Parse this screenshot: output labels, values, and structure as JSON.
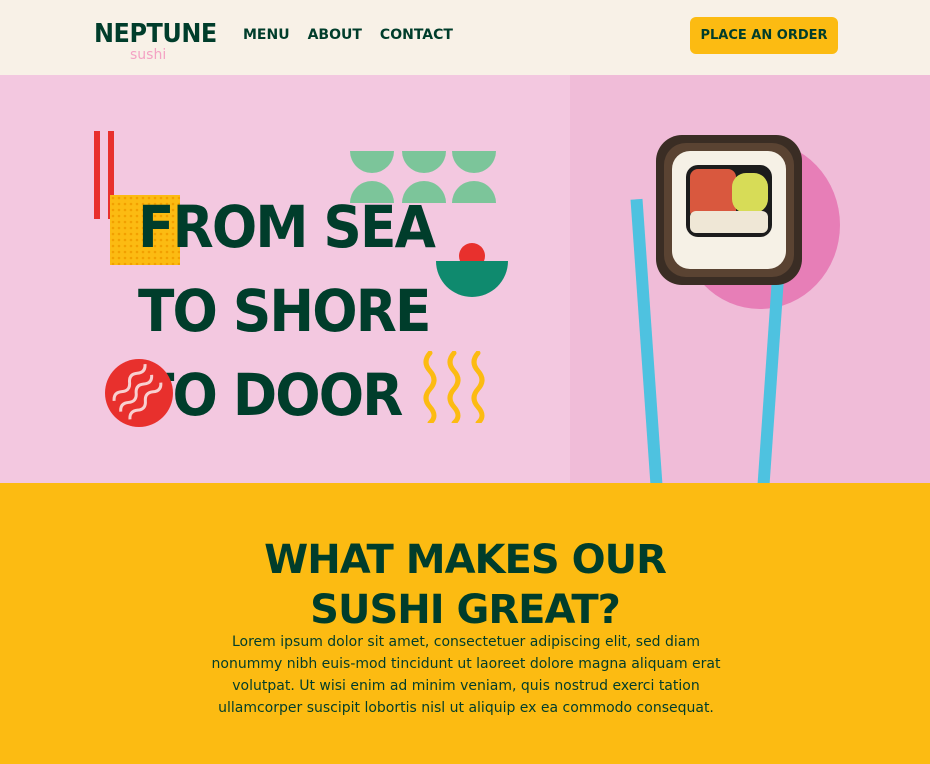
{
  "brand": {
    "name": "NEPTUNE",
    "sub": "sushi"
  },
  "nav": {
    "items": [
      "MENU",
      "ABOUT",
      "CONTACT"
    ]
  },
  "header": {
    "cta": "PLACE AN ORDER"
  },
  "hero": {
    "lines": [
      "FROM SEA",
      "TO SHORE",
      "TO DOOR"
    ]
  },
  "section": {
    "title_lines": [
      "WHAT MAKES OUR",
      "SUSHI GREAT?"
    ],
    "body": "Lorem ipsum dolor sit amet, consectetuer adipiscing elit, sed diam nonummy nibh euis-mod tincidunt ut laoreet dolore magna aliquam erat volutpat. Ut wisi enim ad minim veniam, quis nostrud exerci tation ullamcorper suscipit lobortis nisl ut aliquip ex ea commodo consequat."
  },
  "colors": {
    "green": "#003d2b",
    "yellow": "#fcbb12",
    "pink": "#f3c8e0",
    "cream": "#f8f1e7",
    "red": "#e8302d",
    "mint": "#7cc59a",
    "teal": "#0f8a6e",
    "blue": "#4ec2e0"
  }
}
